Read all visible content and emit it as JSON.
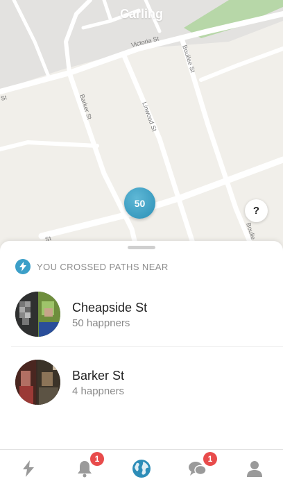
{
  "map": {
    "city_label": "Carling",
    "street_labels": {
      "victoria": "Victoria St",
      "boullee": "Boullee St",
      "barker": "Barker St",
      "linwood": "Linwood St",
      "left_st": "St",
      "boullee_bottom": "Boulle",
      "left_bottom": "St"
    },
    "cluster_count": "50",
    "help_label": "?"
  },
  "sheet": {
    "section_title": "YOU CROSSED PATHS NEAR",
    "places": [
      {
        "name": "Cheapside St",
        "count": "50 happners"
      },
      {
        "name": "Barker St",
        "count": "4 happners"
      }
    ]
  },
  "tabbar": {
    "notifications_badge": "1",
    "messages_badge": "1"
  },
  "colors": {
    "accent": "#3c9fc8",
    "badge": "#e84b4b",
    "map_bg": "#f1efea"
  }
}
